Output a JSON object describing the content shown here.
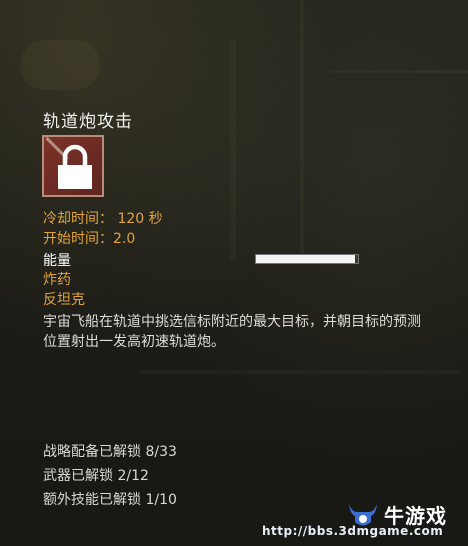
{
  "ability": {
    "title": "轨道炮攻击",
    "cooldown": "冷却时间： 120 秒",
    "start_time": "开始时间：2.0",
    "energy_label": "能量",
    "energy_level": 0.97,
    "tag_explosive": "炸药",
    "tag_antitank": "反坦克",
    "description": "宇宙飞船在轨道中挑选信标附近的最大目标，并朝目标的预测位置射出一发高初速轨道炮。",
    "icon": "padlock-icon"
  },
  "unlocks": {
    "stratagems": "战略配备已解锁 8/33",
    "weapons": "武器已解锁 2/12",
    "perks": "额外技能已解锁 1/10"
  },
  "watermark": {
    "brand": "牛游戏",
    "url": "http://bbs.3dmgame.com"
  },
  "colors": {
    "accent_orange": "#e2a33c",
    "lock_bg": "#6e2d24",
    "lock_border": "#b98c78",
    "text_white": "#f1f1ee"
  }
}
